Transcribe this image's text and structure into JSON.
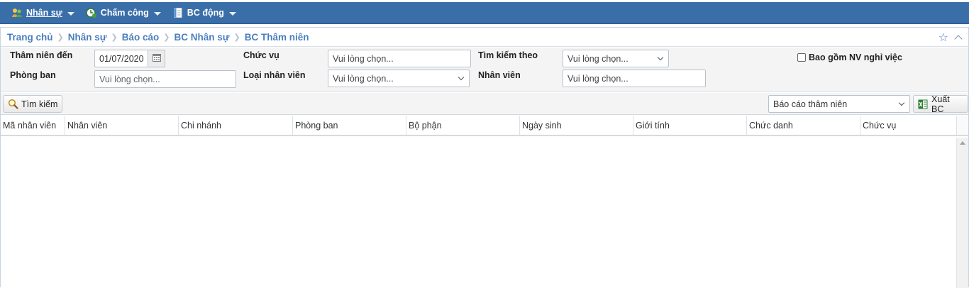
{
  "nav": {
    "items": [
      {
        "label": "Nhân sự",
        "icon": "people-icon"
      },
      {
        "label": "Chấm công",
        "icon": "clock-icon"
      },
      {
        "label": "BC động",
        "icon": "report-icon"
      }
    ]
  },
  "breadcrumb": [
    "Trang chủ",
    "Nhân sự",
    "Báo cáo",
    "BC Nhân sự",
    "BC Thâm niên"
  ],
  "filters": {
    "tham_nien_den_label": "Thâm niên đến",
    "tham_nien_den_value": "01/07/2020",
    "chuc_vu_label": "Chức vụ",
    "chuc_vu_placeholder": "Vui lòng chọn...",
    "tim_kiem_theo_label": "Tìm kiếm theo",
    "tim_kiem_theo_value": "Vui lòng chọn...",
    "bao_gom_label": "Bao gồm NV nghỉ việc",
    "phong_ban_label": "Phòng ban",
    "phong_ban_placeholder": "Vui lòng chọn...",
    "loai_nv_label": "Loại nhân viên",
    "loai_nv_value": "Vui lòng chọn...",
    "nhan_vien_label": "Nhân viên",
    "nhan_vien_placeholder": "Vui lòng chọn..."
  },
  "toolbar": {
    "search_label": "Tìm kiếm",
    "report_select_value": "Báo cáo thâm niên",
    "export_label": "Xuất BC"
  },
  "grid": {
    "columns": [
      "Mã nhân viên",
      "Nhân viên",
      "Chi nhánh",
      "Phòng ban",
      "Bộ phận",
      "Ngày sinh",
      "Giới tính",
      "Chức danh",
      "Chức vụ"
    ]
  },
  "colors": {
    "nav_bg": "#3a6ea8",
    "link": "#4a7fbf"
  }
}
